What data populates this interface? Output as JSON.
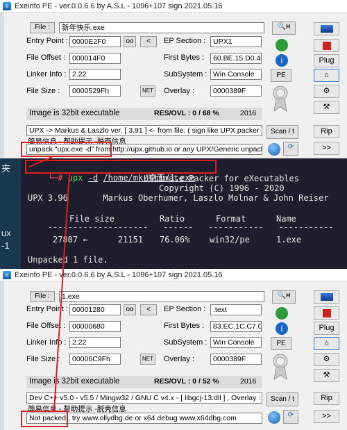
{
  "terminal": {
    "prompt": "└─#",
    "command": "upx",
    "flag": "-d",
    "path1": "/home/mk/桌面",
    "path2": "/1.exe",
    "banner1": "Ultimate Packer for eXecutables",
    "banner2": "Copyright (C) 1996 - 2020",
    "banner3": "UPX 3.96       Markus Oberhumer, Laszlo Molnar & John Reiser",
    "headers": [
      "File size",
      "Ratio",
      "Format",
      "Name"
    ],
    "row": {
      "size": "27807 ←      21151",
      "ratio": "76.06%",
      "format": "win32/pe",
      "name": "1.exe"
    },
    "result": "Unpacked 1 file.",
    "desk_labels": [
      "夹",
      "ux",
      "-1"
    ]
  },
  "win1": {
    "title": "Exeinfo PE - ver.0.0.6.6  by A.S.L -  1096+107 sign  2021.05.16",
    "file_btn": "File :",
    "file_value": "新年快乐.exe",
    "entry_label": "Entry Point :",
    "entry_value": "0000E2F0",
    "oo_btn": "oo",
    "lt_btn": "<",
    "ep_section_label": "EP Section :",
    "ep_section_value": "UPX1",
    "offset_label": "File Offset :",
    "offset_value": "000014F0",
    "first_bytes_label": "First Bytes :",
    "first_bytes_value": "60.BE.15.D0.40",
    "linker_label": "Linker Info :",
    "linker_value": "2.22",
    "subsystem_label": "SubSystem :",
    "subsystem_value": "Win Console",
    "size_label": "File Size :",
    "size_value": "0000529Fh",
    "net_btn": "NET",
    "overlay_label": "Overlay :",
    "overlay_value": "0000389F",
    "status": "Image is 32bit executable",
    "resovl": "RES/OVL : 0 / 68 %",
    "year": "2016",
    "detect": "UPX -> Markus & Laszlo ver. [ 3.91 ] <- from file. ( sign like UPX packer ) , (",
    "hint": "简易信息 - 帮助提示 -脱壳信息",
    "unpack_cmd": "unpack \"upx.exe -d\"",
    "unpack_rest": " from  http://upx.github.io or any UPX/Generic unpacke",
    "pe_btn": "PE",
    "plug_btn": "Plug",
    "scan_btn": "Scan / t",
    "rip_btn": "Rip",
    "next_btn": ">>"
  },
  "win2": {
    "title": "Exeinfo PE - ver.0.0.6.6  by A.S.L -  1096+107 sign  2021.05.16",
    "file_btn": "File :",
    "file_value": "1.exe",
    "entry_label": "Entry Point :",
    "entry_value": "00001280",
    "oo_btn": "oo",
    "lt_btn": "<",
    "ep_section_label": "EP Section :",
    "ep_section_value": ".text",
    "offset_label": "File Offset :",
    "offset_value": "00000680",
    "first_bytes_label": "First Bytes :",
    "first_bytes_value": "83.EC.1C.C7.0",
    "linker_label": "Linker Info :",
    "linker_value": "2.22",
    "subsystem_label": "SubSystem :",
    "subsystem_value": "Win Console",
    "size_label": "File Size :",
    "size_value": "00006C9Fh",
    "net_btn": "NET",
    "overlay_label": "Overlay :",
    "overlay_value": "0000389F",
    "status": "Image is 32bit executable",
    "resovl": "RES/OVL : 0 / 52 %",
    "year": "2016",
    "detect": "Dev C++ v5.0 - v5.5 / Mingw32 / GNU C v4.x - [ libgcj-13.dll ] , Overlay : 2I",
    "hint": "简易信息 - 帮助提示 -脱壳信息",
    "unpack_cmd": "Not packed",
    "unpack_rest": " , try  www.ollydbg.de or x64 debug www.x64dbg.com",
    "pe_btn": "PE",
    "plug_btn": "Plug",
    "scan_btn": "Scan / t",
    "rip_btn": "Rip",
    "next_btn": ">>"
  },
  "colors": {
    "red": "#e02020",
    "terminal_bg": "#1e1e2e",
    "prompt": "#ff4d5e",
    "cmd": "#4fd36a"
  }
}
